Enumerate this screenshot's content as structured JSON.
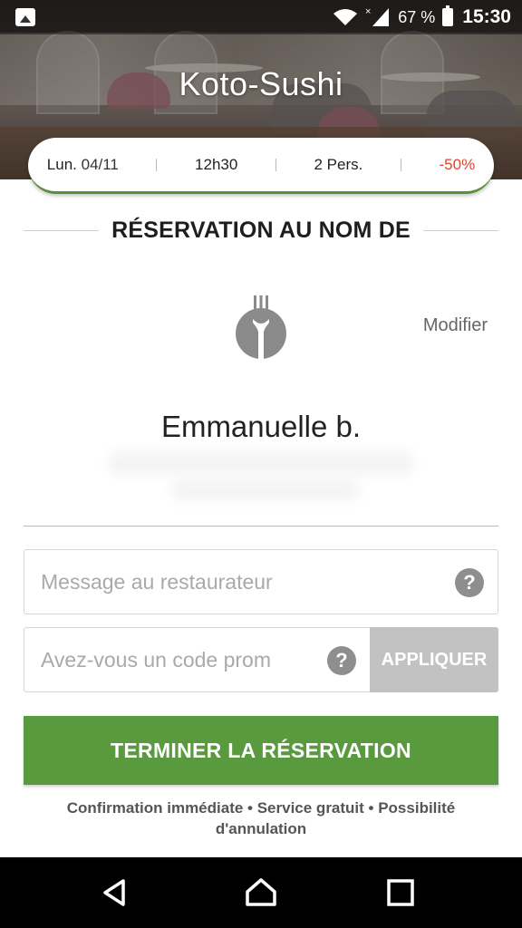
{
  "status_bar": {
    "battery_percent": "67 %",
    "time": "15:30",
    "icons": [
      "gallery-icon",
      "wifi-icon",
      "signal-icon",
      "battery-icon"
    ]
  },
  "restaurant": {
    "name": "Koto-Sushi"
  },
  "booking": {
    "day": "Lun.",
    "date": "04/11",
    "time": "12h30",
    "people": "2 Pers.",
    "discount": "-50%"
  },
  "section": {
    "heading": "RÉSERVATION AU NOM DE"
  },
  "user": {
    "modify_label": "Modifier",
    "name": "Emmanuelle b."
  },
  "form": {
    "message_placeholder": "Message au restaurateur",
    "promo_placeholder": "Avez-vous un code prom",
    "help_glyph": "?",
    "apply_label": "APPLIQUER"
  },
  "cta": {
    "label": "TERMINER LA RÉSERVATION"
  },
  "footnote": "Confirmation immédiate • Service gratuit • Possibilité d'annulation",
  "colors": {
    "accent_green": "#5a9a3f",
    "discount_red": "#e0442d"
  }
}
